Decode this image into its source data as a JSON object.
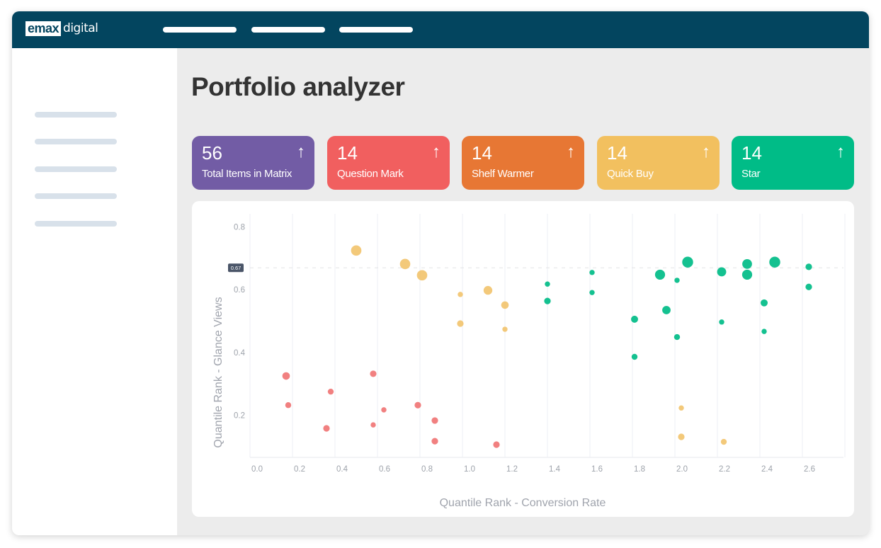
{
  "header": {
    "logo_box": "emax",
    "logo_text": "digital",
    "nav_items": [
      "",
      "",
      ""
    ]
  },
  "sidebar": {
    "items": [
      "",
      "",
      "",
      "",
      ""
    ]
  },
  "page": {
    "title": "Portfolio analyzer"
  },
  "cards": [
    {
      "value": "56",
      "label": "Total Items in Matrix",
      "arrow": "↑",
      "color": "#725ca5"
    },
    {
      "value": "14",
      "label": "Question Mark",
      "arrow": "↑",
      "color": "#f15f5f"
    },
    {
      "value": "14",
      "label": "Shelf Warmer",
      "arrow": "↑",
      "color": "#e77734"
    },
    {
      "value": "14",
      "label": "Quick Buy",
      "arrow": "↑",
      "color": "#f2c05f"
    },
    {
      "value": "14",
      "label": "Star",
      "arrow": "↑",
      "color": "#00bc87"
    }
  ],
  "chart_data": {
    "type": "scatter",
    "title": "",
    "xlabel": "Quantile Rank - Conversion Rate",
    "ylabel": "Quantile Rank - Glance Views",
    "xlim": [
      0,
      2.8
    ],
    "ylim": [
      0,
      0.8
    ],
    "x_ticks": [
      "0.0",
      "0.2",
      "0.4",
      "0.6",
      "0.8",
      "1.0",
      "1.2",
      "1.4",
      "1.6",
      "1.8",
      "2.0",
      "2.2",
      "2.4",
      "2.6"
    ],
    "y_ticks": [
      "0.2",
      "0.4",
      "0.6",
      "0.8"
    ],
    "grid": "vertical",
    "reference_line": {
      "axis": "y",
      "value": 0.67,
      "label": "0.67"
    },
    "series": [
      {
        "name": "Question Mark",
        "color": "#f07575",
        "points": [
          {
            "x": 0.17,
            "y": 0.325,
            "size": 3
          },
          {
            "x": 0.18,
            "y": 0.232,
            "size": 1.5
          },
          {
            "x": 0.36,
            "y": 0.158,
            "size": 2
          },
          {
            "x": 0.38,
            "y": 0.275,
            "size": 1.5
          },
          {
            "x": 0.58,
            "y": 0.332,
            "size": 2
          },
          {
            "x": 0.58,
            "y": 0.169,
            "size": 1
          },
          {
            "x": 0.63,
            "y": 0.217,
            "size": 1
          },
          {
            "x": 0.79,
            "y": 0.232,
            "size": 2
          },
          {
            "x": 0.87,
            "y": 0.183,
            "size": 2
          },
          {
            "x": 0.87,
            "y": 0.117,
            "size": 2
          },
          {
            "x": 1.16,
            "y": 0.106,
            "size": 2
          }
        ]
      },
      {
        "name": "Quick Buy",
        "color": "#f2c46f",
        "points": [
          {
            "x": 0.5,
            "y": 0.725,
            "size": 7
          },
          {
            "x": 0.73,
            "y": 0.682,
            "size": 7
          },
          {
            "x": 0.81,
            "y": 0.646,
            "size": 7
          },
          {
            "x": 0.99,
            "y": 0.585,
            "size": 1
          },
          {
            "x": 0.99,
            "y": 0.492,
            "size": 2
          },
          {
            "x": 1.12,
            "y": 0.598,
            "size": 4.5
          },
          {
            "x": 1.2,
            "y": 0.551,
            "size": 3
          },
          {
            "x": 1.2,
            "y": 0.474,
            "size": 1
          },
          {
            "x": 2.03,
            "y": 0.223,
            "size": 1
          },
          {
            "x": 2.03,
            "y": 0.131,
            "size": 2
          },
          {
            "x": 2.23,
            "y": 0.115,
            "size": 1.5
          }
        ]
      },
      {
        "name": "Star",
        "color": "#00bc87",
        "points": [
          {
            "x": 1.4,
            "y": 0.618,
            "size": 1
          },
          {
            "x": 1.4,
            "y": 0.564,
            "size": 2
          },
          {
            "x": 1.61,
            "y": 0.655,
            "size": 1
          },
          {
            "x": 1.61,
            "y": 0.591,
            "size": 1
          },
          {
            "x": 1.81,
            "y": 0.506,
            "size": 2.5
          },
          {
            "x": 1.81,
            "y": 0.386,
            "size": 1.5
          },
          {
            "x": 1.93,
            "y": 0.648,
            "size": 6.5
          },
          {
            "x": 2.01,
            "y": 0.63,
            "size": 1
          },
          {
            "x": 1.96,
            "y": 0.535,
            "size": 4
          },
          {
            "x": 2.01,
            "y": 0.449,
            "size": 1.5
          },
          {
            "x": 2.06,
            "y": 0.688,
            "size": 8
          },
          {
            "x": 2.22,
            "y": 0.657,
            "size": 5
          },
          {
            "x": 2.22,
            "y": 0.497,
            "size": 1
          },
          {
            "x": 2.34,
            "y": 0.682,
            "size": 6
          },
          {
            "x": 2.34,
            "y": 0.648,
            "size": 6.5
          },
          {
            "x": 2.47,
            "y": 0.688,
            "size": 8
          },
          {
            "x": 2.42,
            "y": 0.558,
            "size": 2.5
          },
          {
            "x": 2.42,
            "y": 0.467,
            "size": 1
          },
          {
            "x": 2.63,
            "y": 0.673,
            "size": 2
          },
          {
            "x": 2.63,
            "y": 0.609,
            "size": 2
          }
        ]
      }
    ]
  }
}
